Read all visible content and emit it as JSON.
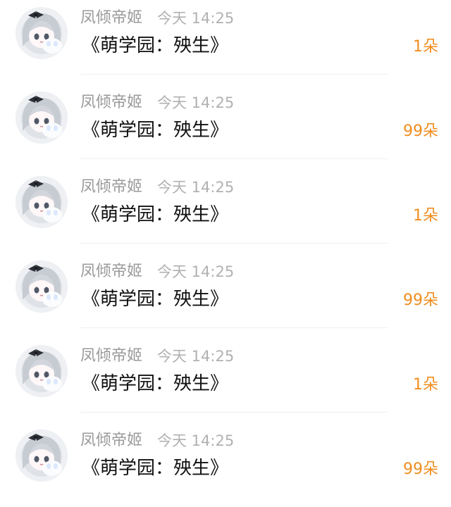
{
  "gifts": [
    {
      "user": "凤倾帝姬",
      "time": "今天 14:25",
      "item": "《萌学园：殃生》",
      "count": "1朵"
    },
    {
      "user": "凤倾帝姬",
      "time": "今天 14:25",
      "item": "《萌学园：殃生》",
      "count": "99朵"
    },
    {
      "user": "凤倾帝姬",
      "time": "今天 14:25",
      "item": "《萌学园：殃生》",
      "count": "1朵"
    },
    {
      "user": "凤倾帝姬",
      "time": "今天 14:25",
      "item": "《萌学园：殃生》",
      "count": "99朵"
    },
    {
      "user": "凤倾帝姬",
      "time": "今天 14:25",
      "item": "《萌学园：殃生》",
      "count": "1朵"
    },
    {
      "user": "凤倾帝姬",
      "time": "今天 14:25",
      "item": "《萌学园：殃生》",
      "count": "99朵"
    }
  ],
  "colors": {
    "username": "#9a9a9a",
    "time": "#b1b1b1",
    "item": "#111111",
    "count": "#f08d1e",
    "divider": "#f0f0f0"
  }
}
